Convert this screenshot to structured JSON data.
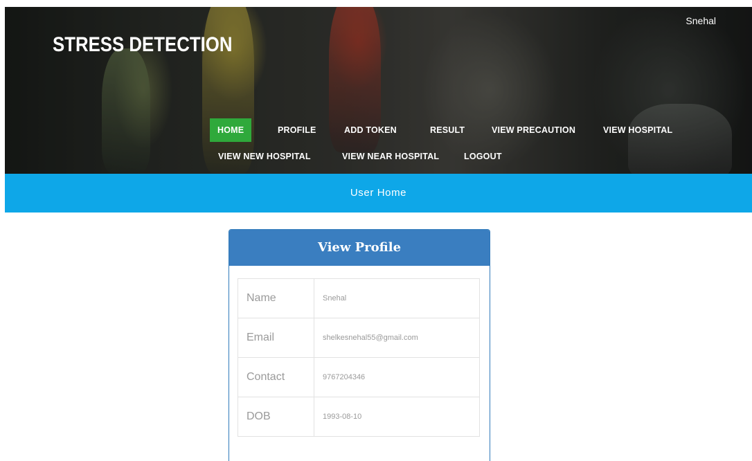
{
  "header": {
    "brand": "STRESS DETECTION",
    "username": "Snehal"
  },
  "nav": {
    "items": [
      {
        "label": "HOME",
        "active": true
      },
      {
        "label": "PROFILE"
      },
      {
        "label": "ADD TOKEN"
      },
      {
        "label": "RESULT"
      },
      {
        "label": "VIEW PRECAUTION"
      },
      {
        "label": "VIEW HOSPITAL"
      },
      {
        "label": "VIEW NEW HOSPITAL"
      },
      {
        "label": "VIEW NEAR HOSPITAL"
      },
      {
        "label": "LOGOUT"
      }
    ]
  },
  "banner": {
    "title": "User Home"
  },
  "profile": {
    "title": "View Profile",
    "rows": [
      {
        "label": "Name",
        "value": "Snehal"
      },
      {
        "label": "Email",
        "value": "shelkesnehal55@gmail.com"
      },
      {
        "label": "Contact",
        "value": "9767204346"
      },
      {
        "label": "DOB",
        "value": "1993-08-10"
      }
    ]
  },
  "colors": {
    "nav_active": "#2fa93b",
    "banner": "#0ea7e8",
    "panel_header": "#3a7ec0"
  }
}
